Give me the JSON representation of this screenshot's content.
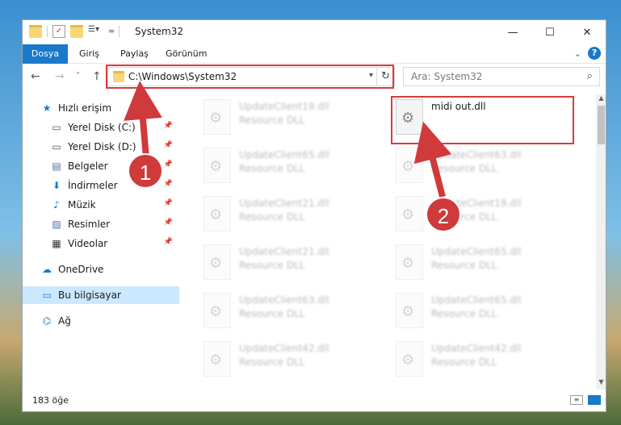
{
  "window": {
    "title": "System32",
    "controls": {
      "minimize": "—",
      "maximize": "☐",
      "close": "✕"
    }
  },
  "ribbon": {
    "tabs": [
      "Dosya",
      "Giriş",
      "Paylaş",
      "Görünüm"
    ],
    "help_label": "?"
  },
  "navigation": {
    "back": "←",
    "forward": "→",
    "recent": "˅",
    "up": "↑",
    "address": "C:\\Windows\\System32",
    "search_placeholder": "Ara: System32"
  },
  "sidebar": {
    "items": [
      {
        "label": "Hızlı erişim",
        "icon": "star-icon",
        "pinned": false
      },
      {
        "label": "Yerel Disk (C:)",
        "icon": "drive-icon",
        "pinned": true
      },
      {
        "label": "Yerel Disk (D:)",
        "icon": "drive-icon",
        "pinned": true
      },
      {
        "label": "Belgeler",
        "icon": "document-icon",
        "pinned": true
      },
      {
        "label": "İndirmeler",
        "icon": "download-icon",
        "pinned": true
      },
      {
        "label": "Müzik",
        "icon": "music-icon",
        "pinned": true
      },
      {
        "label": "Resimler",
        "icon": "pictures-icon",
        "pinned": true
      },
      {
        "label": "Videolar",
        "icon": "video-icon",
        "pinned": true
      },
      {
        "label": "OneDrive",
        "icon": "cloud-icon",
        "pinned": false
      },
      {
        "label": "Bu bilgisayar",
        "icon": "computer-icon",
        "pinned": false,
        "selected": true
      },
      {
        "label": "Ağ",
        "icon": "network-icon",
        "pinned": false
      }
    ]
  },
  "files": [
    {
      "name": "UpdateClient19.dll",
      "type": "Resource DLL",
      "blurred": true
    },
    {
      "name": "midi out.dll",
      "type": "",
      "blurred": false,
      "highlighted": true
    },
    {
      "name": "UpdateClient65.dll",
      "type": "Resource DLL",
      "blurred": true
    },
    {
      "name": "UpdateClient63.dll",
      "type": "Resource DLL",
      "blurred": true
    },
    {
      "name": "UpdateClient21.dll",
      "type": "Resource DLL",
      "blurred": true
    },
    {
      "name": "UpdateClient19.dll",
      "type": "Resource DLL",
      "blurred": true
    },
    {
      "name": "UpdateClient21.dll",
      "type": "Resource DLL",
      "blurred": true
    },
    {
      "name": "UpdateClient65.dll",
      "type": "Resource DLL",
      "blurred": true
    },
    {
      "name": "UpdateClient63.dll",
      "type": "Resource DLL",
      "blurred": true
    },
    {
      "name": "UpdateClient65.dll",
      "type": "Resource DLL",
      "blurred": true
    },
    {
      "name": "UpdateClient42.dll",
      "type": "Resource DLL",
      "blurred": true
    },
    {
      "name": "UpdateClient42.dll",
      "type": "Resource DLL",
      "blurred": true
    }
  ],
  "status": {
    "item_count": "183 öğe"
  },
  "annotations": {
    "step1": "1",
    "step2": "2",
    "highlight_color": "#d93a3a"
  }
}
